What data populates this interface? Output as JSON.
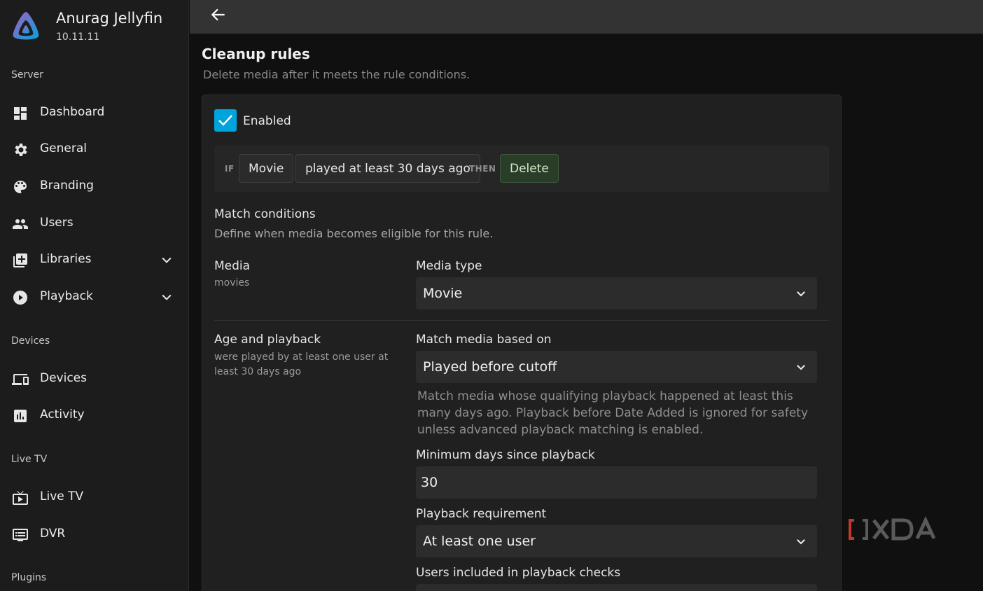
{
  "app": {
    "server_name": "Anurag Jellyfin",
    "version": "10.11.11"
  },
  "sidebar": {
    "sections": {
      "server": "Server",
      "devices": "Devices",
      "live_tv": "Live TV",
      "plugins": "Plugins"
    },
    "items": [
      {
        "label": "Dashboard",
        "icon": "dashboard-icon"
      },
      {
        "label": "General",
        "icon": "gear-icon"
      },
      {
        "label": "Branding",
        "icon": "palette-icon"
      },
      {
        "label": "Users",
        "icon": "users-icon"
      },
      {
        "label": "Libraries",
        "icon": "library-add-icon",
        "expandable": true
      },
      {
        "label": "Playback",
        "icon": "play-circle-icon",
        "expandable": true
      },
      {
        "label": "Devices",
        "icon": "devices-icon"
      },
      {
        "label": "Activity",
        "icon": "activity-chart-icon"
      },
      {
        "label": "Live TV",
        "icon": "live-tv-icon"
      },
      {
        "label": "DVR",
        "icon": "dvr-icon"
      }
    ]
  },
  "page": {
    "title": "Cleanup rules",
    "subtitle": "Delete media after it meets the rule conditions."
  },
  "rule": {
    "enabled_label": "Enabled",
    "enabled": true,
    "summary": {
      "if_keyword": "IF",
      "media": "Movie",
      "condition": "played at least 30 days ago",
      "then_keyword": "THEN",
      "action": "Delete"
    },
    "match_conditions": {
      "title": "Match conditions",
      "description": "Define when media becomes eligible for this rule."
    },
    "media": {
      "label": "Media",
      "summary": "movies",
      "media_type_label": "Media type",
      "media_type_value": "Movie"
    },
    "age_playback": {
      "label": "Age and playback",
      "summary": "were played by at least one user at least 30 days ago",
      "match_based_label": "Match media based on",
      "match_based_value": "Played before cutoff",
      "help_text": "Match media whose qualifying playback happened at least this many days ago. Playback before Date Added is ignored for safety unless advanced playback matching is enabled.",
      "min_days_label": "Minimum days since playback",
      "min_days_value": "30",
      "requirement_label": "Playback requirement",
      "requirement_value": "At least one user",
      "users_label": "Users included in playback checks"
    }
  },
  "colors": {
    "accent": "#00a4dc",
    "delete_chip": "#2a3d29",
    "sidebar_bg": "#1c1c1c",
    "topbar_bg": "#333333"
  }
}
